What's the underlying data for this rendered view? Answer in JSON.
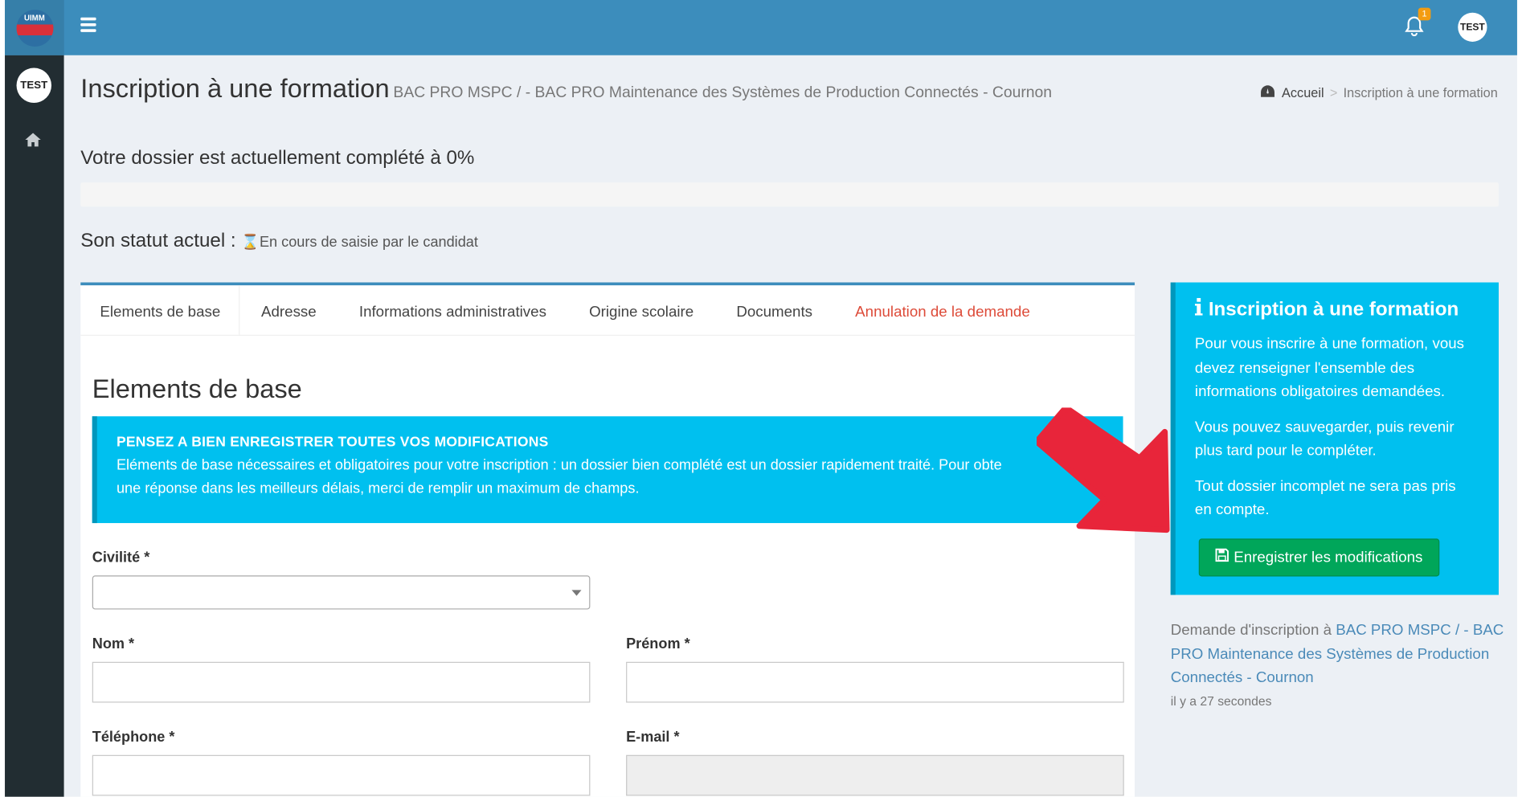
{
  "brand": {
    "logo_text": "UIMM"
  },
  "header": {
    "notification_count": "1",
    "user_avatar": "TEST"
  },
  "sidebar": {
    "user_avatar": "TEST"
  },
  "page": {
    "title": "Inscription à une formation",
    "subtitle": "BAC PRO MSPC / - BAC PRO Maintenance des Systèmes de Production Connectés - Cournon",
    "breadcrumb": {
      "home": "Accueil",
      "separator": ">",
      "current": "Inscription à une formation"
    },
    "progress_text": "Votre dossier est actuellement complété à 0%",
    "progress_percent": 0,
    "status_label": "Son statut actuel :",
    "status_value": "En cours de saisie par le candidat"
  },
  "tabs": [
    {
      "label": "Elements de base",
      "active": true
    },
    {
      "label": "Adresse"
    },
    {
      "label": "Informations administratives"
    },
    {
      "label": "Origine scolaire"
    },
    {
      "label": "Documents"
    },
    {
      "label": "Annulation de la demande",
      "danger": true
    }
  ],
  "form": {
    "section_title": "Elements de base",
    "callout_title": "PENSEZ A BIEN ENREGISTRER TOUTES VOS MODIFICATIONS",
    "callout_text": "Eléments de base nécessaires et obligatoires pour votre inscription : un dossier bien complété est un dossier rapidement traité. Pour obte",
    "callout_text_2": "une réponse dans les meilleurs délais, merci de remplir un maximum de champs.",
    "civilite_label": "Civilité *",
    "nom_label": "Nom *",
    "prenom_label": "Prénom *",
    "telephone_label": "Téléphone *",
    "email_label": "E-mail *"
  },
  "infobox": {
    "title": "Inscription à une formation",
    "p1": "Pour vous inscrire à une formation, vous devez renseigner l'ensemble des informations obligatoires demandées.",
    "p2": "Vous pouvez sauvegarder, puis revenir plus tard pour le compléter.",
    "p3": "Tout dossier incomplet ne sera pas pris en compte.",
    "save_label": "Enregistrer les modifications"
  },
  "request": {
    "prefix": "Demande d'inscription à",
    "link": "BAC PRO MSPC / - BAC PRO Maintenance des Systèmes de Production Connectés - Cournon",
    "time": "il y a 27 secondes"
  },
  "colors": {
    "header": "#3c8dbc",
    "sidebar": "#222d32",
    "info": "#00c0ef",
    "success": "#00a65a",
    "danger": "#dd4b39",
    "annotation_arrow": "#e8253a"
  }
}
